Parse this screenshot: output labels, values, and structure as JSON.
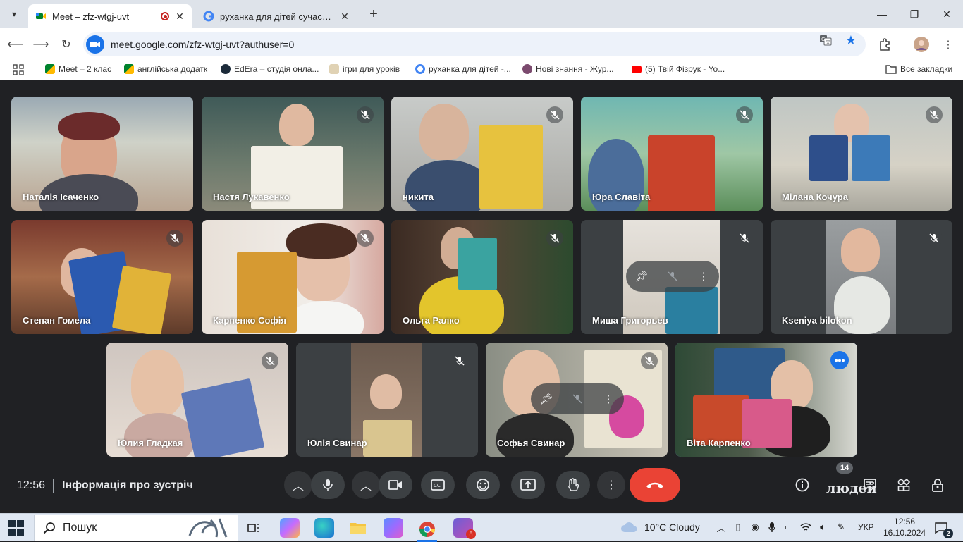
{
  "browser": {
    "tabs": [
      {
        "title": "Meet – zfz-wtgj-uvt",
        "active": true
      },
      {
        "title": "руханка для дітей сучасна - По",
        "active": false
      }
    ],
    "url": "meet.google.com/zfz-wtgj-uvt?authuser=0",
    "bookmarks": [
      {
        "label": "Meet – 2 клас"
      },
      {
        "label": "англійська додатк"
      },
      {
        "label": "EdEra – студія онла..."
      },
      {
        "label": "ігри для уроків"
      },
      {
        "label": "руханка для дітей -..."
      },
      {
        "label": "Нові знання - Жур..."
      },
      {
        "label": "(5) Твій Фізрук - Yo..."
      }
    ],
    "all_bookmarks": "Все закладки"
  },
  "participants": [
    {
      "name": "Наталія Ісаченко"
    },
    {
      "name": "Настя Лукавенко"
    },
    {
      "name": "никита"
    },
    {
      "name": "Юра Славіта"
    },
    {
      "name": "Мілана Кочура"
    },
    {
      "name": "Степан Гомела"
    },
    {
      "name": "Карпенко Софія"
    },
    {
      "name": "Ольга Ралко"
    },
    {
      "name": "Миша Григорьев"
    },
    {
      "name": "Kseniya bilokon"
    },
    {
      "name": "Юлия Гладкая"
    },
    {
      "name": "Юлія Свинар"
    },
    {
      "name": "Софья Свинар"
    },
    {
      "name": "Віта Карпенко"
    }
  ],
  "controls": {
    "time": "12:56",
    "meeting_info": "Інформація про зустріч",
    "people_count": "14",
    "people_label": "людей"
  },
  "taskbar": {
    "search_placeholder": "Пошук",
    "weather": "10°C  Cloudy",
    "language": "УКР",
    "time": "12:56",
    "date": "16.10.2024",
    "teams_badge": "8",
    "notifications": "2"
  },
  "colors": {
    "meet_bg": "#202124",
    "end_call": "#ea4335",
    "accent": "#1a73e8"
  }
}
